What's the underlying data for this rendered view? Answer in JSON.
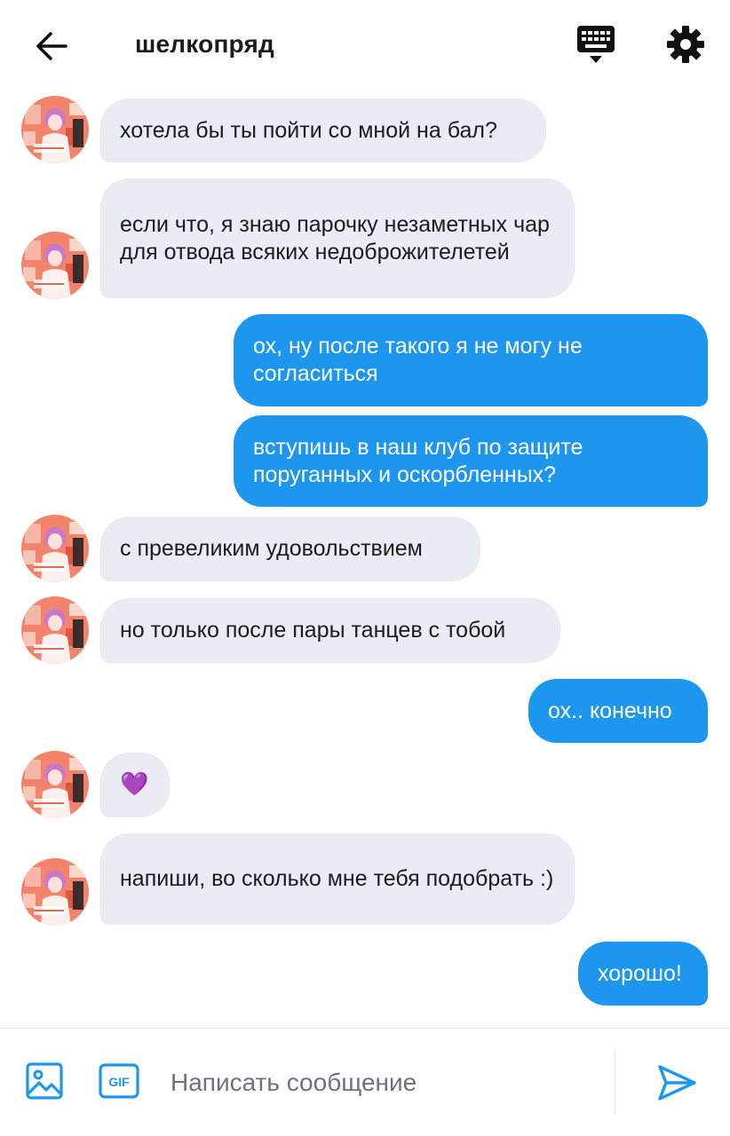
{
  "header": {
    "title": "шелкопряд",
    "back_icon": "arrow-left-icon",
    "keyboard_icon": "keyboard-icon",
    "settings_icon": "gear-icon"
  },
  "messages": [
    {
      "from": "them",
      "text": "хотела бы ты пойти со мной на бал?"
    },
    {
      "from": "them",
      "text": "если что, я знаю парочку незаметных чар для отвода всяких недоброжителетей"
    },
    {
      "from": "me",
      "text": "ох, ну после такого я не могу не согласиться"
    },
    {
      "from": "me",
      "text": "вступишь в наш клуб по защите поруганных и оскорбленных?"
    },
    {
      "from": "them",
      "text": "с превеликим удовольствием"
    },
    {
      "from": "them",
      "text": "но только после пары танцев с тобой"
    },
    {
      "from": "me",
      "text": "ох.. конечно"
    },
    {
      "from": "them",
      "text": "💜"
    },
    {
      "from": "them",
      "text": "напиши, во сколько мне тебя подобрать :)"
    },
    {
      "from": "me",
      "text": "хорошо!"
    }
  ],
  "composer": {
    "image_icon": "image-icon",
    "gif_label": "GIF",
    "placeholder": "Написать сообщение",
    "value": "",
    "send_icon": "send-icon"
  },
  "colors": {
    "incoming_bubble": "#e9ecf2",
    "outgoing_bubble": "#1d97ee",
    "accent": "#1d97ee"
  }
}
